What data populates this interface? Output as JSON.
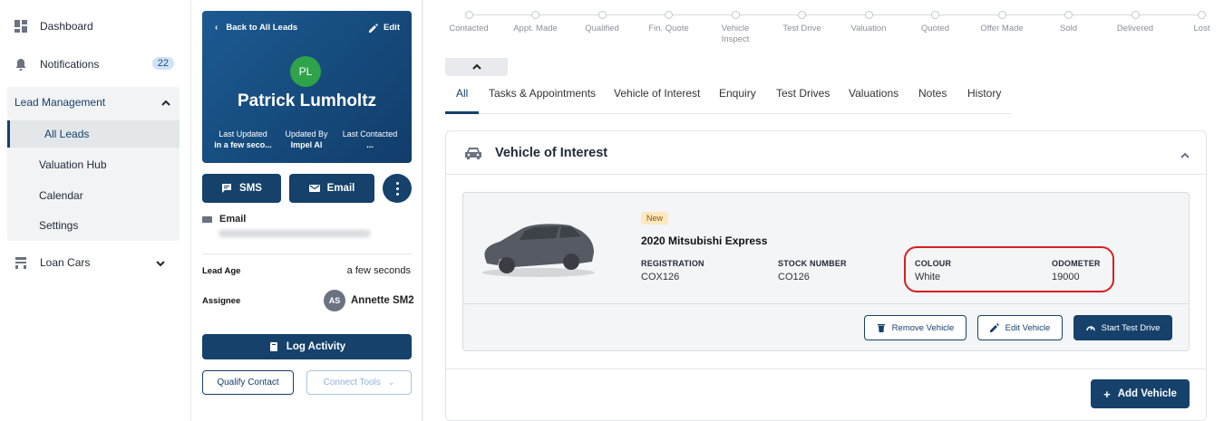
{
  "nav": {
    "dashboard": "Dashboard",
    "notifications": "Notifications",
    "notifications_count": "22",
    "lead_management": "Lead Management",
    "sub_items": [
      "All Leads",
      "Valuation Hub",
      "Calendar",
      "Settings"
    ],
    "loan_cars": "Loan Cars"
  },
  "lead": {
    "back": "Back to All Leads",
    "edit": "Edit",
    "initials": "PL",
    "name": "Patrick Lumholtz",
    "meta": [
      {
        "label": "Last Updated",
        "value": "in a few seco..."
      },
      {
        "label": "Updated By",
        "value": "Impel AI"
      },
      {
        "label": "Last Contacted",
        "value": "..."
      }
    ],
    "sms": "SMS",
    "email_btn": "Email",
    "email_label": "Email",
    "lead_age_label": "Lead Age",
    "lead_age_value": "a few seconds",
    "assignee_label": "Assignee",
    "assignee_initials": "AS",
    "assignee_name": "Annette SM2",
    "log_activity": "Log Activity",
    "qualify_contact": "Qualify Contact",
    "connect_tools": "Connect Tools"
  },
  "stages": [
    "Contacted",
    "Appt. Made",
    "Qualified",
    "Fin. Quote",
    "Vehicle Inspect",
    "Test Drive",
    "Valuation",
    "Quoted",
    "Offer Made",
    "Sold",
    "Delivered",
    "Lost"
  ],
  "tabs": [
    "All",
    "Tasks & Appointments",
    "Vehicle of Interest",
    "Enquiry",
    "Test Drives",
    "Valuations",
    "Notes",
    "History"
  ],
  "panel": {
    "title": "Vehicle of Interest",
    "vehicle": {
      "tag": "New",
      "title": "2020 Mitsubishi Express",
      "registration_label": "REGISTRATION",
      "registration": "COX126",
      "stock_label": "STOCK NUMBER",
      "stock": "CO126",
      "colour_label": "COLOUR",
      "colour": "White",
      "odometer_label": "ODOMETER",
      "odometer": "19000"
    },
    "remove_vehicle": "Remove Vehicle",
    "edit_vehicle": "Edit Vehicle",
    "start_test_drive": "Start Test Drive",
    "add_vehicle": "Add Vehicle"
  },
  "colors": {
    "primary": "#15416b",
    "avatar": "#2fa34a",
    "highlight": "#d62020"
  }
}
